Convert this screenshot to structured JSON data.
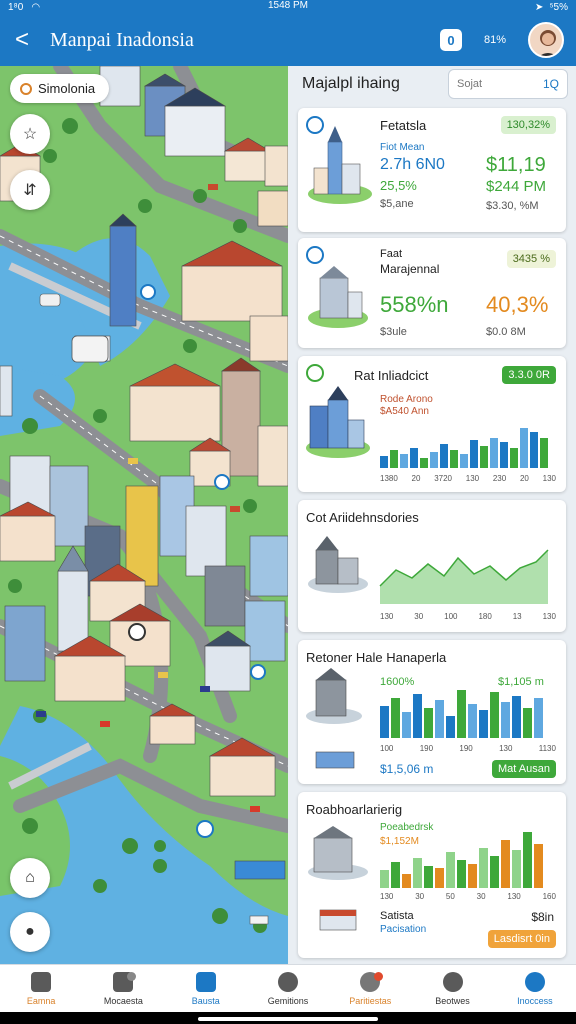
{
  "status": {
    "left": "1⁸0",
    "time": "1548 PM",
    "right": "⁵5%"
  },
  "header": {
    "back_label": "<",
    "title": "Manpai Inadonsia",
    "badge_label": "0",
    "battery_label": "81%"
  },
  "map": {
    "location_chip": "Simolonia"
  },
  "panel": {
    "title": "Majalpl ihaing",
    "search": {
      "value": "Sojat",
      "icon": "1Q"
    }
  },
  "cards": [
    {
      "title": "Fetatsla",
      "pill": "130,32%",
      "sub1": "Fiot  Mean",
      "sub2": "2.7h 6N0",
      "sub3": "25,5%",
      "sub4": "$5,ane",
      "value1": "$11,19",
      "value2": "$244 PM",
      "value3": "$3.30, %M"
    },
    {
      "title": "Faat",
      "subtitle": "Marajennal",
      "pill": "3435 %",
      "value_left": "558%n",
      "value_right": "40,3%",
      "foot_left": "$3ule",
      "foot_right": "$0.0 8M"
    },
    {
      "title": "Rat Inliadcict",
      "pill": "3.3.0 0R",
      "sub1": "Rode Arono",
      "sub2": "$A540 Ann",
      "ticks": [
        "1380",
        "20",
        "3720",
        "130",
        "230",
        "20",
        "130"
      ]
    },
    {
      "title": "Cot Ariidehnsdories",
      "ticks": [
        "130",
        "30",
        "100",
        "180",
        "13",
        "130"
      ]
    },
    {
      "title": "Retoner Hale Hanaperla",
      "sub1": "1600%",
      "sub2": "$1,105 m",
      "ticks": [
        "100",
        "190",
        "190",
        "130",
        "1130"
      ],
      "value": "$1,5,06 m",
      "button": "Mat Ausan"
    },
    {
      "title": "Roabhoarlarierig",
      "sub1": "Poeabedrsk",
      "sub2": "$1,152M",
      "ticks": [
        "130",
        "30",
        "50",
        "30",
        "130",
        "160"
      ],
      "foot_title": "Satista",
      "foot_sub": "Pacisation",
      "foot_value": "$8in",
      "button": "Lasdisrt 0in"
    }
  ],
  "nav": [
    {
      "label": "Eamna",
      "color": "#d9822b"
    },
    {
      "label": "Mocaesta",
      "color": "#333333"
    },
    {
      "label": "Bausta",
      "color": "#1c78c4"
    },
    {
      "label": "Gemitions",
      "color": "#333333"
    },
    {
      "label": "Paritiestas",
      "color": "#d9822b"
    },
    {
      "label": "Beotwes",
      "color": "#333333"
    },
    {
      "label": "Inoccess",
      "color": "#1c78c4"
    }
  ],
  "colors": {
    "header": "#1c78c4",
    "water": "#63b3e3",
    "grass": "#79c56a",
    "road": "#8d8f94",
    "accent_green": "#3ea83a",
    "accent_orange": "#e38a1f"
  }
}
